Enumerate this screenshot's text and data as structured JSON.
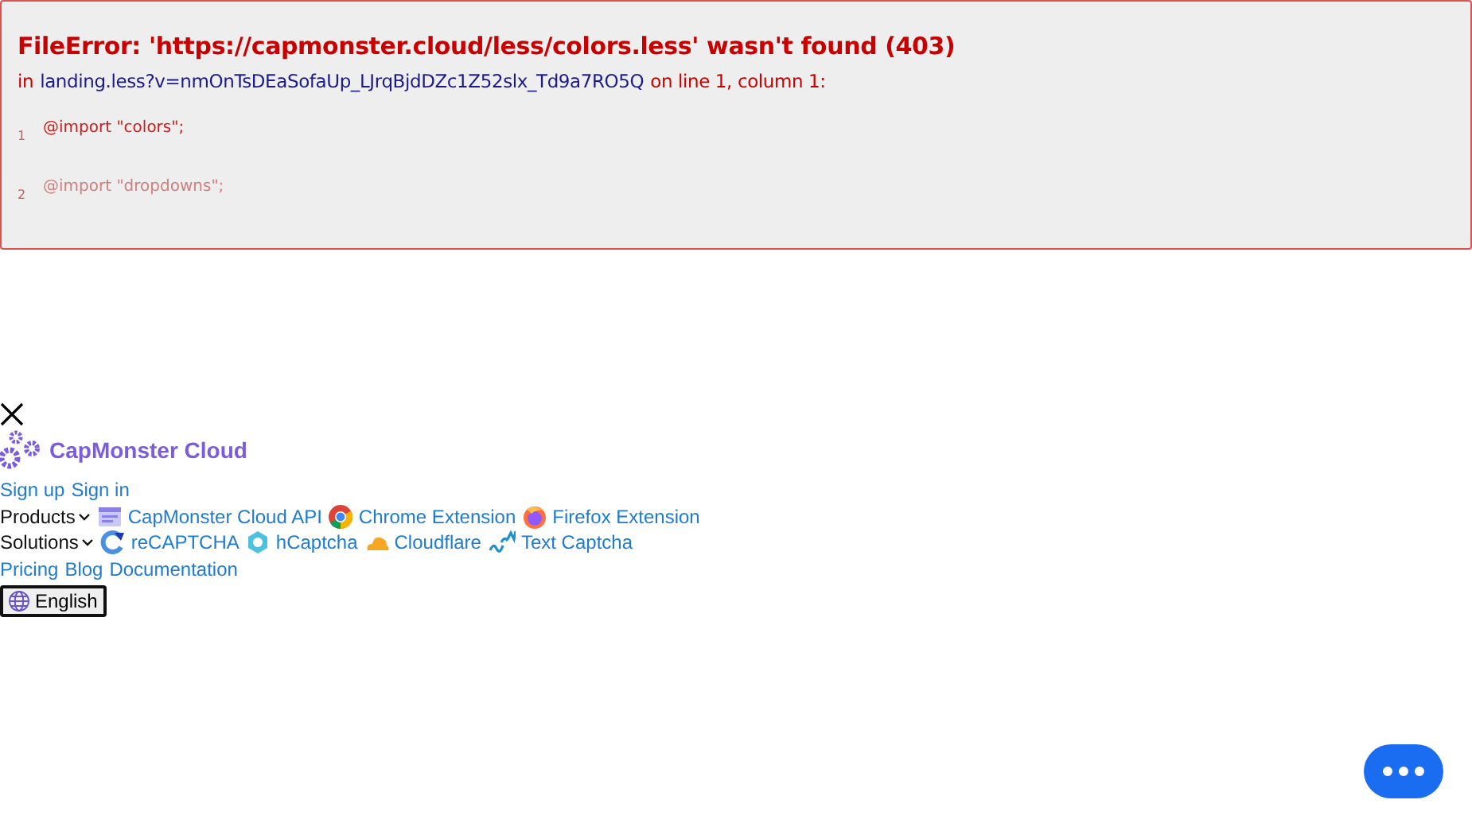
{
  "error": {
    "title": "FileError: 'https://capmonster.cloud/less/colors.less' wasn't found (403)",
    "location": {
      "prefix": "in",
      "file": "landing.less?v=nmOnTsDEaSofaUp_LJrqBjdDZc1Z52slx_Td9a7RO5Q",
      "suffix": "on line 1, column 1:"
    },
    "lines": [
      {
        "number": "1",
        "code": "@import \"colors\";",
        "highlighted": true
      },
      {
        "number": "2",
        "code": "@import \"dropdowns\";",
        "highlighted": false
      }
    ]
  },
  "nav": {
    "logo": "CapMonster Cloud",
    "auth_links": [
      "Sign up",
      "Sign in"
    ],
    "menus": [
      {
        "label": "Products",
        "items": [
          {
            "label": "CapMonster Cloud API",
            "kind": "api"
          },
          {
            "label": "Chrome Extension",
            "kind": "chrome"
          },
          {
            "label": "Firefox Extension",
            "kind": "firefox"
          }
        ]
      },
      {
        "label": "Solutions",
        "items": [
          {
            "label": "reCAPTCHA",
            "kind": "recaptcha"
          },
          {
            "label": "hCaptcha",
            "kind": "hcaptcha"
          },
          {
            "label": "Cloudflare",
            "kind": "cloudflare"
          },
          {
            "label": "Text Captcha",
            "kind": "text"
          }
        ]
      }
    ],
    "links": [
      "Pricing",
      "Blog",
      "Documentation"
    ],
    "language": "English"
  }
}
